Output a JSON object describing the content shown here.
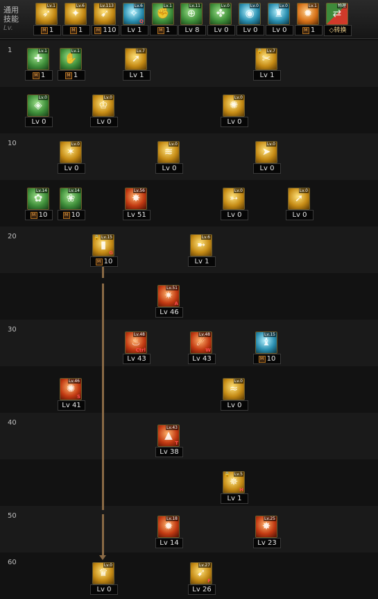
{
  "general": {
    "label_line1": "通用",
    "label_line2": "技能",
    "lv": "Lv."
  },
  "row_labels": [
    "1",
    "10",
    "20",
    "30",
    "40",
    "50",
    "60"
  ],
  "top_skills": [
    {
      "name": "top-skill-1",
      "color": "gold",
      "icon": "dash-icon",
      "mini": "Lv.1",
      "level": "1",
      "m": true
    },
    {
      "name": "top-skill-2",
      "color": "gold",
      "icon": "kick-icon",
      "mini": "Lv.6",
      "level": "1",
      "m": true
    },
    {
      "name": "top-skill-3",
      "color": "gold",
      "icon": "spear-icon",
      "mini": "Lv.113",
      "level": "110",
      "m": true
    },
    {
      "name": "top-skill-4",
      "color": "blue",
      "icon": "wing-icon",
      "mini": "Lv.6",
      "level": "Lv 1",
      "m": false,
      "key": "Q"
    },
    {
      "name": "top-skill-5",
      "color": "green",
      "icon": "arm-icon",
      "mini": "Lv.1",
      "level": "1",
      "m": true
    },
    {
      "name": "top-skill-6",
      "color": "green",
      "icon": "crosshair-icon",
      "mini": "Lv.11",
      "level": "Lv 8",
      "m": false
    },
    {
      "name": "top-skill-7",
      "color": "green",
      "icon": "boot-icon",
      "mini": "Lv.0",
      "level": "Lv 0",
      "m": false
    },
    {
      "name": "top-skill-8",
      "color": "blue",
      "icon": "eye-icon",
      "mini": "Lv.0",
      "level": "Lv 0",
      "m": false
    },
    {
      "name": "top-skill-9",
      "color": "blue",
      "icon": "figure-icon",
      "mini": "Lv.0",
      "level": "Lv 0",
      "m": false
    },
    {
      "name": "top-skill-10",
      "color": "orange",
      "icon": "burst-icon",
      "mini": "Lv.1",
      "level": "1",
      "m": true
    },
    {
      "name": "top-skill-11",
      "color": "mixed",
      "icon": "swap-icon",
      "mini": "物理",
      "level": "◇转换",
      "m": false
    }
  ],
  "skills": [
    {
      "name": "skill-r1-c1",
      "color": "green",
      "icon": "shield-bash-icon",
      "mini": "Lv.1",
      "level": "1",
      "m": true
    },
    {
      "name": "skill-r1-c2",
      "color": "green",
      "icon": "grab-icon",
      "mini": "Lv.1",
      "level": "1",
      "m": true
    },
    {
      "name": "skill-r1-c3",
      "color": "gold",
      "icon": "jump-strike-icon",
      "mini": "Lv.7",
      "level": "Lv 1",
      "m": false
    },
    {
      "name": "skill-r1-c4",
      "color": "gold",
      "icon": "slash-icon",
      "mini": "Lv.7",
      "level": "Lv 1",
      "m": false,
      "lock": true
    },
    {
      "name": "skill-r2-c1",
      "color": "green",
      "icon": "guard-icon",
      "mini": "Lv.0",
      "level": "Lv 0",
      "m": false
    },
    {
      "name": "skill-r2-c2",
      "color": "gold",
      "icon": "cup-icon",
      "mini": "Lv.0",
      "level": "Lv 0",
      "m": false
    },
    {
      "name": "skill-r2-c3",
      "color": "gold",
      "icon": "gear-icon",
      "mini": "Lv.0",
      "level": "Lv 0",
      "m": false
    },
    {
      "name": "skill-r3-c1",
      "color": "gold",
      "icon": "spark-strike-icon",
      "mini": "Lv.0",
      "level": "Lv 0",
      "m": false
    },
    {
      "name": "skill-r3-c2",
      "color": "gold",
      "icon": "multi-slash-icon",
      "mini": "Lv.0",
      "level": "Lv 0",
      "m": false
    },
    {
      "name": "skill-r3-c3",
      "color": "gold",
      "icon": "arrow-rush-icon",
      "mini": "Lv.0",
      "level": "Lv 0",
      "m": false
    },
    {
      "name": "skill-r4-c1",
      "color": "green",
      "icon": "flame-aura-icon",
      "mini": "Lv.14",
      "level": "10",
      "m": true
    },
    {
      "name": "skill-r4-c2",
      "color": "green",
      "icon": "leaf-icon",
      "mini": "Lv.14",
      "level": "10",
      "m": true
    },
    {
      "name": "skill-r4-c3",
      "color": "red",
      "icon": "explosion-icon",
      "mini": "Lv.56",
      "level": "Lv 51",
      "m": false
    },
    {
      "name": "skill-r4-c4",
      "color": "gold",
      "icon": "sweep-icon",
      "mini": "Lv.0",
      "level": "Lv 0",
      "m": false
    },
    {
      "name": "skill-r4-c5",
      "color": "gold",
      "icon": "thrust-icon",
      "mini": "Lv.0",
      "level": "Lv 0",
      "m": false
    },
    {
      "name": "skill-r5-c1",
      "color": "gold",
      "icon": "pillar-icon",
      "mini": "Lv.15",
      "level": "10",
      "m": true,
      "lock": true,
      "key": "G"
    },
    {
      "name": "skill-r5-c2",
      "color": "gold",
      "icon": "lunge-icon",
      "mini": "Lv.6",
      "level": "Lv 1",
      "m": false
    },
    {
      "name": "skill-r6-c1",
      "color": "red",
      "icon": "fire-burst-icon",
      "mini": "Lv.51",
      "level": "Lv 46",
      "m": false,
      "key": "A"
    },
    {
      "name": "skill-r7-c1",
      "color": "red",
      "icon": "dragon-icon",
      "mini": "Lv.48",
      "level": "Lv 43",
      "m": false,
      "key": "Ctrl"
    },
    {
      "name": "skill-r7-c2",
      "color": "red",
      "icon": "meteor-icon",
      "mini": "Lv.48",
      "level": "Lv 43",
      "m": false,
      "key": "W"
    },
    {
      "name": "skill-r7-c3",
      "color": "blue",
      "icon": "spirit-icon",
      "mini": "Lv.15",
      "level": "10",
      "m": true
    },
    {
      "name": "skill-r8-c1",
      "color": "red",
      "icon": "nova-icon",
      "mini": "Lv.46",
      "level": "Lv 41",
      "m": false,
      "key": "S"
    },
    {
      "name": "skill-r8-c2",
      "color": "gold",
      "icon": "wave-icon",
      "mini": "Lv.0",
      "level": "Lv 0",
      "m": false
    },
    {
      "name": "skill-r9-c1",
      "color": "red",
      "icon": "eruption-icon",
      "mini": "Lv.43",
      "level": "Lv 38",
      "m": false,
      "key": "T"
    },
    {
      "name": "skill-r10-c1",
      "color": "gold",
      "icon": "storm-icon",
      "mini": "Lv.5",
      "level": "Lv 1",
      "m": false,
      "lock": true,
      "key": "H"
    },
    {
      "name": "skill-r11-c1",
      "color": "red",
      "icon": "blaze-icon",
      "mini": "Lv.18",
      "level": "Lv 14",
      "m": false
    },
    {
      "name": "skill-r11-c2",
      "color": "red",
      "icon": "inferno-icon",
      "mini": "Lv.25",
      "level": "Lv 23",
      "m": false
    },
    {
      "name": "skill-r12-c1",
      "color": "gold",
      "icon": "ultimate-icon",
      "mini": "Lv.0",
      "level": "Lv 0",
      "m": false
    },
    {
      "name": "skill-r12-c2",
      "color": "gold",
      "icon": "finisher-icon",
      "mini": "Lv.27",
      "level": "Lv 26",
      "m": false,
      "key": "F"
    }
  ]
}
